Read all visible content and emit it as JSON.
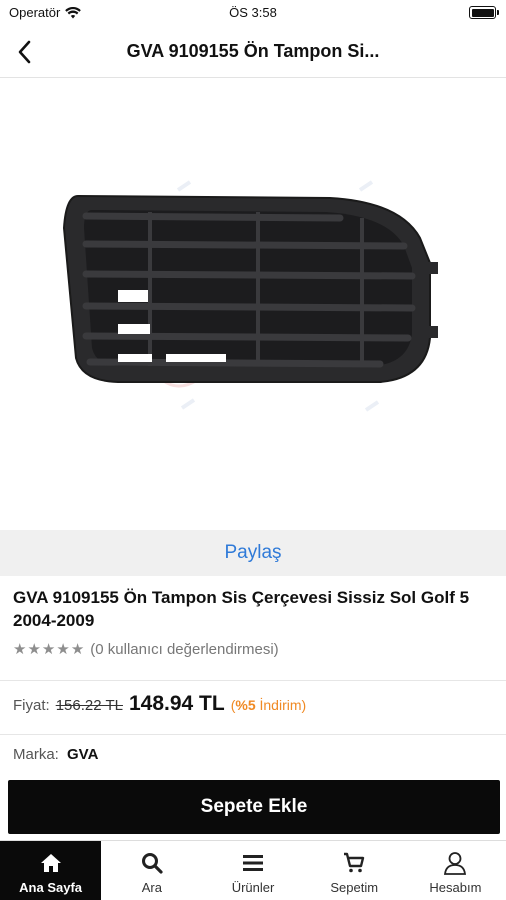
{
  "status_bar": {
    "carrier": "Operatör",
    "time": "ÖS 3:58"
  },
  "nav": {
    "title": "GVA 9109155 Ön Tampon Si..."
  },
  "share": {
    "label": "Paylaş"
  },
  "product": {
    "title": "GVA 9109155 Ön Tampon Sis Çerçevesi Sissiz Sol Golf 5 2004-2009",
    "rating_stars": 0,
    "rating_text": "(0 kullanıcı değerlendirmesi)",
    "price_label": "Fiyat:",
    "old_price": "156.22 TL",
    "new_price": "148.94 TL",
    "discount_open": "(",
    "discount_value": "%5",
    "discount_text": "İndirim)",
    "brand_label": "Marka:",
    "brand_value": "GVA"
  },
  "actions": {
    "add_to_cart": "Sepete Ekle"
  },
  "tabs": [
    {
      "label": "Ana Sayfa",
      "icon": "home-icon",
      "active": true
    },
    {
      "label": "Ara",
      "icon": "search-icon",
      "active": false
    },
    {
      "label": "Ürünler",
      "icon": "menu-icon",
      "active": false
    },
    {
      "label": "Sepetim",
      "icon": "cart-icon",
      "active": false
    },
    {
      "label": "Hesabım",
      "icon": "user-icon",
      "active": false
    }
  ],
  "colors": {
    "accent_link": "#2f7ad8",
    "discount": "#f08a24",
    "primary_button": "#0a0a0a"
  }
}
